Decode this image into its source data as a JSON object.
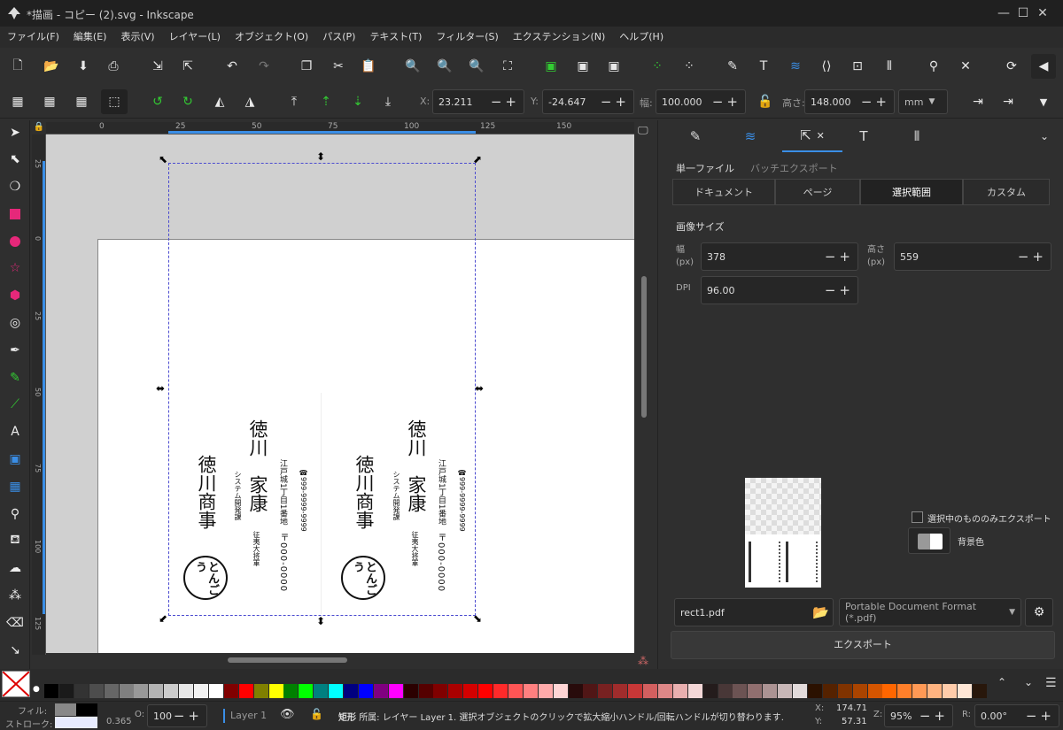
{
  "window": {
    "title": "*描画 - コピー (2).svg - Inkscape",
    "minimize": "—",
    "maximize": "☐",
    "close": "✕"
  },
  "menu": [
    "ファイル(F)",
    "編集(E)",
    "表示(V)",
    "レイヤー(L)",
    "オブジェクト(O)",
    "パス(P)",
    "テキスト(T)",
    "フィルター(S)",
    "エクステンション(N)",
    "ヘルプ(H)"
  ],
  "controls": {
    "x_label": "X:",
    "x_value": "23.211",
    "y_label": "Y:",
    "y_value": "-24.647",
    "w_label": "幅:",
    "w_value": "100.000",
    "h_label": "高さ:",
    "h_value": "148.000",
    "unit": "mm"
  },
  "ruler": {
    "top_ticks": [
      "0",
      "25",
      "50",
      "75",
      "100",
      "125",
      "150"
    ],
    "left_ticks": [
      "25",
      "0",
      "25",
      "50",
      "75",
      "100",
      "125"
    ]
  },
  "card": {
    "company": "徳川商事",
    "name": "徳川　家康",
    "dept": "システム開発課",
    "role": "征夷大将軍",
    "zip": "〒000-0000",
    "address": "江戸城1丁目1番地",
    "phone": "☎999-9999-9999",
    "logo": "とんごう"
  },
  "panel": {
    "subtabs": [
      "単一ファイル",
      "バッチエクスポート"
    ],
    "segments": [
      "ドキュメント",
      "ページ",
      "選択範囲",
      "カスタム"
    ],
    "active_segment": "選択範囲",
    "image_size": "画像サイズ",
    "width_label": "幅",
    "px": "(px)",
    "width_value": "378",
    "height_label": "高さ",
    "height_value": "559",
    "dpi_label": "DPI",
    "dpi_value": "96.00",
    "only_selected": "選択中のもののみエクスポート",
    "bg_label": "背景色",
    "filename": "rect1.pdf",
    "format": "Portable Document Format (*.pdf)",
    "export_button": "エクスポート"
  },
  "status": {
    "fill_label": "フィル:",
    "stroke_label": "ストローク:",
    "stroke_width": "0.365",
    "opacity_label": "O:",
    "opacity_value": "100",
    "layer": "Layer 1",
    "message_type": "矩形",
    "message": "所属: レイヤー Layer 1. 選択オブジェクトのクリックで拡大縮小ハンドル/回転ハンドルが切り替わります.",
    "cursor_x_label": "X:",
    "cursor_x": "174.71",
    "cursor_y_label": "Y:",
    "cursor_y": "57.31",
    "zoom_label": "Z:",
    "zoom": "95%",
    "rotation_label": "R:",
    "rotation": "0.00°"
  },
  "colors": {
    "accent": "#3a8ee6",
    "palette": [
      "#000000",
      "#1a1a1a",
      "#333333",
      "#4d4d4d",
      "#666666",
      "#808080",
      "#999999",
      "#b3b3b3",
      "#cccccc",
      "#e6e6e6",
      "#f2f2f2",
      "#ffffff",
      "#800000",
      "#ff0000",
      "#808000",
      "#ffff00",
      "#008000",
      "#00ff00",
      "#008080",
      "#00ffff",
      "#000080",
      "#0000ff",
      "#800080",
      "#ff00ff",
      "#2b0000",
      "#550000",
      "#800000",
      "#aa0000",
      "#d40000",
      "#ff0000",
      "#ff2a2a",
      "#ff5555",
      "#ff8080",
      "#ffaaaa",
      "#ffd5d5",
      "#280b0b",
      "#501616",
      "#782121",
      "#a02c2c",
      "#c83737",
      "#d35f5f",
      "#de8787",
      "#e9afaf",
      "#f4d7d7",
      "#241c1c",
      "#483737",
      "#6c5353",
      "#916f6f",
      "#ac9393",
      "#c8b7b7",
      "#e3dbdb",
      "#2b1100",
      "#552200",
      "#803300",
      "#aa4400",
      "#d45500",
      "#ff6600",
      "#ff7f2a",
      "#ff9955",
      "#ffb380",
      "#ffccaa",
      "#ffe6d5",
      "#28170b"
    ]
  }
}
